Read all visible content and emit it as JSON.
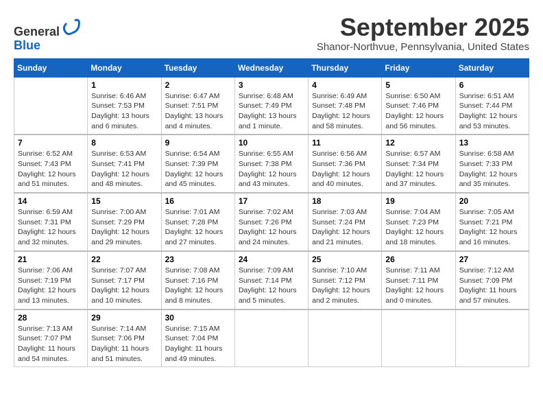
{
  "logo": {
    "line1": "General",
    "line2": "Blue"
  },
  "title": "September 2025",
  "subtitle": "Shanor-Northvue, Pennsylvania, United States",
  "days_of_week": [
    "Sunday",
    "Monday",
    "Tuesday",
    "Wednesday",
    "Thursday",
    "Friday",
    "Saturday"
  ],
  "weeks": [
    [
      {
        "day": "",
        "sunrise": "",
        "sunset": "",
        "daylight": ""
      },
      {
        "day": "1",
        "sunrise": "Sunrise: 6:46 AM",
        "sunset": "Sunset: 7:53 PM",
        "daylight": "Daylight: 13 hours and 6 minutes."
      },
      {
        "day": "2",
        "sunrise": "Sunrise: 6:47 AM",
        "sunset": "Sunset: 7:51 PM",
        "daylight": "Daylight: 13 hours and 4 minutes."
      },
      {
        "day": "3",
        "sunrise": "Sunrise: 6:48 AM",
        "sunset": "Sunset: 7:49 PM",
        "daylight": "Daylight: 13 hours and 1 minute."
      },
      {
        "day": "4",
        "sunrise": "Sunrise: 6:49 AM",
        "sunset": "Sunset: 7:48 PM",
        "daylight": "Daylight: 12 hours and 58 minutes."
      },
      {
        "day": "5",
        "sunrise": "Sunrise: 6:50 AM",
        "sunset": "Sunset: 7:46 PM",
        "daylight": "Daylight: 12 hours and 56 minutes."
      },
      {
        "day": "6",
        "sunrise": "Sunrise: 6:51 AM",
        "sunset": "Sunset: 7:44 PM",
        "daylight": "Daylight: 12 hours and 53 minutes."
      }
    ],
    [
      {
        "day": "7",
        "sunrise": "Sunrise: 6:52 AM",
        "sunset": "Sunset: 7:43 PM",
        "daylight": "Daylight: 12 hours and 51 minutes."
      },
      {
        "day": "8",
        "sunrise": "Sunrise: 6:53 AM",
        "sunset": "Sunset: 7:41 PM",
        "daylight": "Daylight: 12 hours and 48 minutes."
      },
      {
        "day": "9",
        "sunrise": "Sunrise: 6:54 AM",
        "sunset": "Sunset: 7:39 PM",
        "daylight": "Daylight: 12 hours and 45 minutes."
      },
      {
        "day": "10",
        "sunrise": "Sunrise: 6:55 AM",
        "sunset": "Sunset: 7:38 PM",
        "daylight": "Daylight: 12 hours and 43 minutes."
      },
      {
        "day": "11",
        "sunrise": "Sunrise: 6:56 AM",
        "sunset": "Sunset: 7:36 PM",
        "daylight": "Daylight: 12 hours and 40 minutes."
      },
      {
        "day": "12",
        "sunrise": "Sunrise: 6:57 AM",
        "sunset": "Sunset: 7:34 PM",
        "daylight": "Daylight: 12 hours and 37 minutes."
      },
      {
        "day": "13",
        "sunrise": "Sunrise: 6:58 AM",
        "sunset": "Sunset: 7:33 PM",
        "daylight": "Daylight: 12 hours and 35 minutes."
      }
    ],
    [
      {
        "day": "14",
        "sunrise": "Sunrise: 6:59 AM",
        "sunset": "Sunset: 7:31 PM",
        "daylight": "Daylight: 12 hours and 32 minutes."
      },
      {
        "day": "15",
        "sunrise": "Sunrise: 7:00 AM",
        "sunset": "Sunset: 7:29 PM",
        "daylight": "Daylight: 12 hours and 29 minutes."
      },
      {
        "day": "16",
        "sunrise": "Sunrise: 7:01 AM",
        "sunset": "Sunset: 7:28 PM",
        "daylight": "Daylight: 12 hours and 27 minutes."
      },
      {
        "day": "17",
        "sunrise": "Sunrise: 7:02 AM",
        "sunset": "Sunset: 7:26 PM",
        "daylight": "Daylight: 12 hours and 24 minutes."
      },
      {
        "day": "18",
        "sunrise": "Sunrise: 7:03 AM",
        "sunset": "Sunset: 7:24 PM",
        "daylight": "Daylight: 12 hours and 21 minutes."
      },
      {
        "day": "19",
        "sunrise": "Sunrise: 7:04 AM",
        "sunset": "Sunset: 7:23 PM",
        "daylight": "Daylight: 12 hours and 18 minutes."
      },
      {
        "day": "20",
        "sunrise": "Sunrise: 7:05 AM",
        "sunset": "Sunset: 7:21 PM",
        "daylight": "Daylight: 12 hours and 16 minutes."
      }
    ],
    [
      {
        "day": "21",
        "sunrise": "Sunrise: 7:06 AM",
        "sunset": "Sunset: 7:19 PM",
        "daylight": "Daylight: 12 hours and 13 minutes."
      },
      {
        "day": "22",
        "sunrise": "Sunrise: 7:07 AM",
        "sunset": "Sunset: 7:17 PM",
        "daylight": "Daylight: 12 hours and 10 minutes."
      },
      {
        "day": "23",
        "sunrise": "Sunrise: 7:08 AM",
        "sunset": "Sunset: 7:16 PM",
        "daylight": "Daylight: 12 hours and 8 minutes."
      },
      {
        "day": "24",
        "sunrise": "Sunrise: 7:09 AM",
        "sunset": "Sunset: 7:14 PM",
        "daylight": "Daylight: 12 hours and 5 minutes."
      },
      {
        "day": "25",
        "sunrise": "Sunrise: 7:10 AM",
        "sunset": "Sunset: 7:12 PM",
        "daylight": "Daylight: 12 hours and 2 minutes."
      },
      {
        "day": "26",
        "sunrise": "Sunrise: 7:11 AM",
        "sunset": "Sunset: 7:11 PM",
        "daylight": "Daylight: 12 hours and 0 minutes."
      },
      {
        "day": "27",
        "sunrise": "Sunrise: 7:12 AM",
        "sunset": "Sunset: 7:09 PM",
        "daylight": "Daylight: 11 hours and 57 minutes."
      }
    ],
    [
      {
        "day": "28",
        "sunrise": "Sunrise: 7:13 AM",
        "sunset": "Sunset: 7:07 PM",
        "daylight": "Daylight: 11 hours and 54 minutes."
      },
      {
        "day": "29",
        "sunrise": "Sunrise: 7:14 AM",
        "sunset": "Sunset: 7:06 PM",
        "daylight": "Daylight: 11 hours and 51 minutes."
      },
      {
        "day": "30",
        "sunrise": "Sunrise: 7:15 AM",
        "sunset": "Sunset: 7:04 PM",
        "daylight": "Daylight: 11 hours and 49 minutes."
      },
      {
        "day": "",
        "sunrise": "",
        "sunset": "",
        "daylight": ""
      },
      {
        "day": "",
        "sunrise": "",
        "sunset": "",
        "daylight": ""
      },
      {
        "day": "",
        "sunrise": "",
        "sunset": "",
        "daylight": ""
      },
      {
        "day": "",
        "sunrise": "",
        "sunset": "",
        "daylight": ""
      }
    ]
  ]
}
